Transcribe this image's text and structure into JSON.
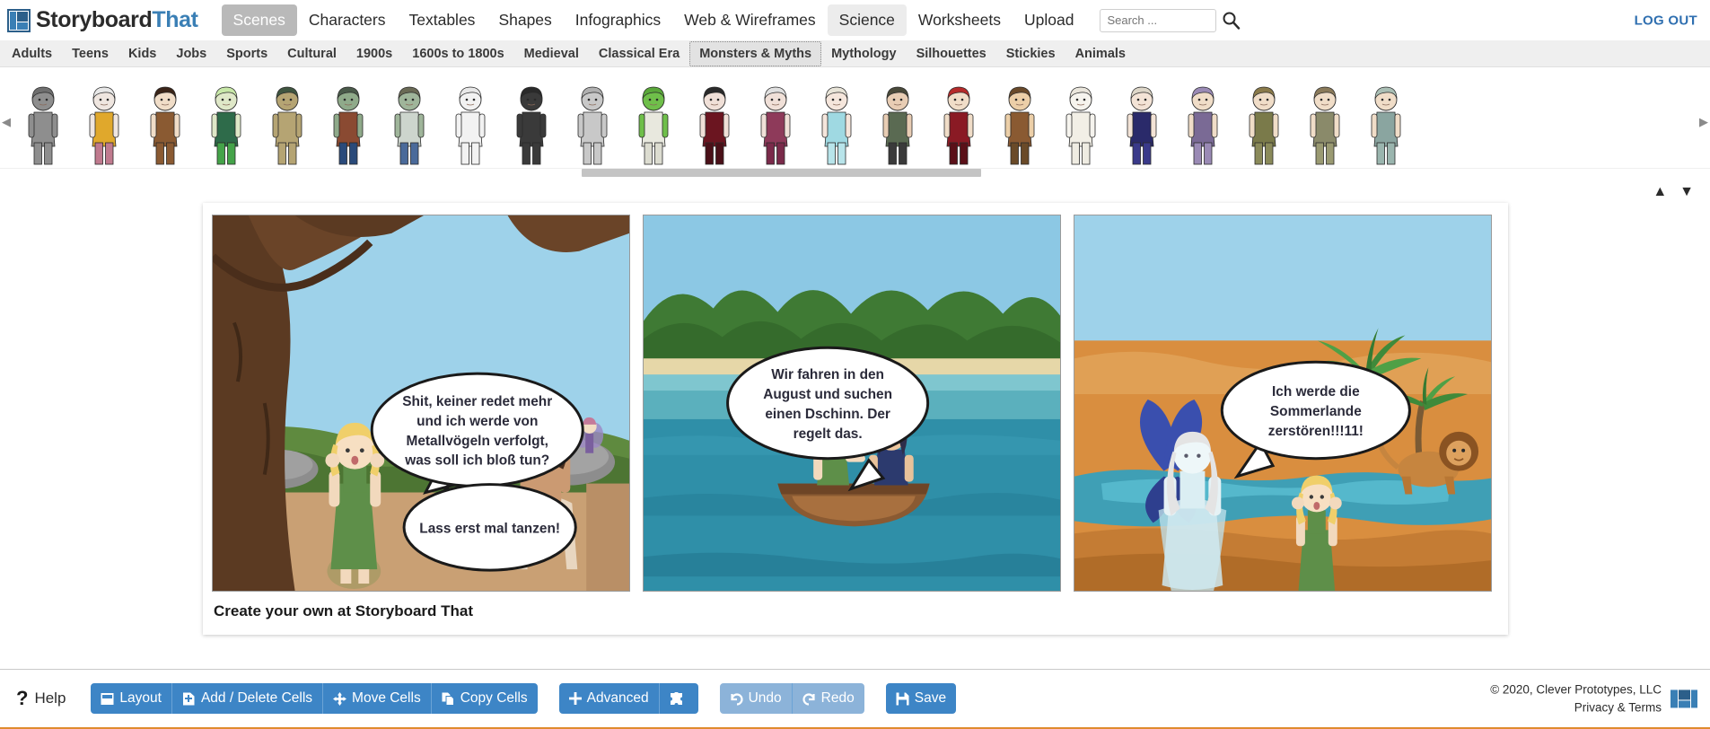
{
  "app": {
    "logo_primary": "Storyboard",
    "logo_secondary": "That",
    "logout_label": "LOG OUT"
  },
  "topnav": {
    "items": [
      {
        "label": "Scenes",
        "state": "normal"
      },
      {
        "label": "Characters",
        "state": "active"
      },
      {
        "label": "Textables",
        "state": "normal"
      },
      {
        "label": "Shapes",
        "state": "normal"
      },
      {
        "label": "Infographics",
        "state": "normal"
      },
      {
        "label": "Web & Wireframes",
        "state": "normal"
      },
      {
        "label": "Science",
        "state": "hover"
      },
      {
        "label": "Worksheets",
        "state": "normal"
      },
      {
        "label": "Upload",
        "state": "normal"
      }
    ]
  },
  "search": {
    "placeholder": "Search ...",
    "value": "",
    "icon": "search-icon"
  },
  "categories": {
    "items": [
      {
        "label": "Adults",
        "active": false
      },
      {
        "label": "Teens",
        "active": false
      },
      {
        "label": "Kids",
        "active": false
      },
      {
        "label": "Jobs",
        "active": false
      },
      {
        "label": "Sports",
        "active": false
      },
      {
        "label": "Cultural",
        "active": false
      },
      {
        "label": "1900s",
        "active": false
      },
      {
        "label": "1600s to 1800s",
        "active": false
      },
      {
        "label": "Medieval",
        "active": false
      },
      {
        "label": "Classical Era",
        "active": false
      },
      {
        "label": "Monsters & Myths",
        "active": true
      },
      {
        "label": "Mythology",
        "active": false
      },
      {
        "label": "Silhouettes",
        "active": false
      },
      {
        "label": "Stickies",
        "active": false
      },
      {
        "label": "Animals",
        "active": false
      }
    ]
  },
  "character_strip": {
    "left_arrow": "chevron-left-icon",
    "right_arrow": "chevron-right-icon",
    "scrollbar_position_pct": 42,
    "characters": [
      {
        "name": "cat-person",
        "skin": "#8e8e8e",
        "hair": "#6f6f6f",
        "top": "#8e8e8e",
        "bottom": "#8e8e8e"
      },
      {
        "name": "harpy",
        "skin": "#efe6e0",
        "hair": "#e8e8e8",
        "top": "#e0a82c",
        "bottom": "#c07a8e"
      },
      {
        "name": "satyr",
        "skin": "#f0ddc8",
        "hair": "#3a2418",
        "top": "#8a5a32",
        "bottom": "#8a5a32"
      },
      {
        "name": "mermaid",
        "skin": "#dfe8c8",
        "hair": "#c8e8a8",
        "top": "#2e6b4a",
        "bottom": "#44a349"
      },
      {
        "name": "dryad",
        "skin": "#b5a473",
        "hair": "#3f5540",
        "top": "#b5a473",
        "bottom": "#b5a473"
      },
      {
        "name": "zombie-man",
        "skin": "#8faa8a",
        "hair": "#4a5a4a",
        "top": "#8a4a32",
        "bottom": "#2a4a7a"
      },
      {
        "name": "zombie-boy",
        "skin": "#9fb59a",
        "hair": "#6a6a55",
        "top": "#cdd5cd",
        "bottom": "#4a6a9a"
      },
      {
        "name": "skeleton",
        "skin": "#f2f2f2",
        "hair": "#e8e8e8",
        "top": "#f2f2f2",
        "bottom": "#f2f2f2"
      },
      {
        "name": "grim-reaper",
        "skin": "#3a3a3a",
        "hair": "#2a2a2a",
        "top": "#3a3a3a",
        "bottom": "#3a3a3a"
      },
      {
        "name": "robot",
        "skin": "#c8c8c8",
        "hair": "#b0b0b0",
        "top": "#c8c8c8",
        "bottom": "#c8c8c8"
      },
      {
        "name": "alien",
        "skin": "#6fbf4a",
        "hair": "#5aa83a",
        "top": "#e8e8de",
        "bottom": "#dcdcd0"
      },
      {
        "name": "vampire",
        "skin": "#f0e0d8",
        "hair": "#2a2a2a",
        "top": "#6b1520",
        "bottom": "#4a1018"
      },
      {
        "name": "wizard",
        "skin": "#f0e0d8",
        "hair": "#e0e0e0",
        "top": "#8e3a5a",
        "bottom": "#7a2a4a"
      },
      {
        "name": "ice-princess",
        "skin": "#f5e6dc",
        "hair": "#e8e4d8",
        "top": "#9fd9e2",
        "bottom": "#b8e4ea"
      },
      {
        "name": "woodsman",
        "skin": "#e8cdb4",
        "hair": "#4a4a3a",
        "top": "#5a6a52",
        "bottom": "#3a3a3a"
      },
      {
        "name": "red-riding-hood",
        "skin": "#f0ddc8",
        "hair": "#b52a2a",
        "top": "#8a1a24",
        "bottom": "#5a1018"
      },
      {
        "name": "hunter",
        "skin": "#eccfa8",
        "hair": "#6a4a2a",
        "top": "#8a5a32",
        "bottom": "#6a4a28"
      },
      {
        "name": "ghost",
        "skin": "#f6f4ee",
        "hair": "#eae6dc",
        "top": "#f2efe6",
        "bottom": "#efece2"
      },
      {
        "name": "angel",
        "skin": "#f3e3d6",
        "hair": "#ddd6c8",
        "top": "#2a2a6a",
        "bottom": "#3a3a8a"
      },
      {
        "name": "fairy-blue",
        "skin": "#f0ddc8",
        "hair": "#9a8ab5",
        "top": "#7a6a95",
        "bottom": "#9a8ab5"
      },
      {
        "name": "fairy-green",
        "skin": "#f0ddc8",
        "hair": "#8a7a4a",
        "top": "#7a7a4a",
        "bottom": "#8a8a5a"
      },
      {
        "name": "fairy-brown",
        "skin": "#f0ddc8",
        "hair": "#8a7a5a",
        "top": "#8a8a6a",
        "bottom": "#9a9a72"
      },
      {
        "name": "fairy-teal",
        "skin": "#f0ddc8",
        "hair": "#aabfb5",
        "top": "#8aa5a0",
        "bottom": "#9ab5ae"
      }
    ]
  },
  "board": {
    "caption": "Create your own at Storyboard That",
    "vertical_arrows": {
      "up": "triangle-up-icon",
      "down": "triangle-down-icon"
    },
    "cells": [
      {
        "name": "cell-1-forest",
        "scene": "forest",
        "bubbles": [
          {
            "type": "speech-oval",
            "lines": [
              "Shit, keiner redet mehr",
              "und ich werde von",
              "Metallvögeln verfolgt,",
              "was soll ich bloß tun?"
            ]
          },
          {
            "type": "speech-oval",
            "lines": [
              "Lass erst mal tanzen!"
            ]
          }
        ]
      },
      {
        "name": "cell-2-lake",
        "scene": "lake-boat",
        "bubbles": [
          {
            "type": "speech-oval",
            "lines": [
              "Wir fahren in den",
              "August und suchen",
              "einen Dschinn. Der",
              "regelt das."
            ]
          }
        ]
      },
      {
        "name": "cell-3-desert",
        "scene": "desert-oasis",
        "bubbles": [
          {
            "type": "speech-oval",
            "lines": [
              "Ich werde die",
              "Sommerlande",
              "zerstören!!!11!"
            ]
          }
        ]
      }
    ]
  },
  "toolbar": {
    "help_label": "Help",
    "help_icon": "question-mark-icon",
    "groups": [
      {
        "name": "cells-group",
        "buttons": [
          {
            "label": "Layout",
            "icon": "layout-icon",
            "disabled": false
          },
          {
            "label": "Add / Delete Cells",
            "icon": "add-delete-icon",
            "disabled": false
          },
          {
            "label": "Move Cells",
            "icon": "move-arrows-icon",
            "disabled": false
          },
          {
            "label": "Copy Cells",
            "icon": "copy-icon",
            "disabled": false
          }
        ]
      },
      {
        "name": "advanced-group",
        "buttons": [
          {
            "label": "Advanced",
            "icon": "plus-icon",
            "disabled": false
          },
          {
            "label": "",
            "icon": "puzzle-icon",
            "disabled": false
          }
        ]
      },
      {
        "name": "history-group",
        "buttons": [
          {
            "label": "Undo",
            "icon": "undo-icon",
            "disabled": true
          },
          {
            "label": "Redo",
            "icon": "redo-icon",
            "disabled": true
          }
        ]
      },
      {
        "name": "save-group",
        "buttons": [
          {
            "label": "Save",
            "icon": "floppy-disk-icon",
            "disabled": false
          }
        ]
      }
    ]
  },
  "footer": {
    "copyright": "© 2020, Clever Prototypes, LLC",
    "privacy": "Privacy & Terms",
    "logo": "storyboard-logo-icon"
  },
  "colors": {
    "accent_blue": "#3d85c6",
    "accent_blue_disabled": "#8cb3d9",
    "link_blue": "#2f6fb0",
    "orange_rule": "#e08b2e",
    "catbar_bg": "#efefef",
    "active_tab_bg": "#b9b9b9"
  }
}
